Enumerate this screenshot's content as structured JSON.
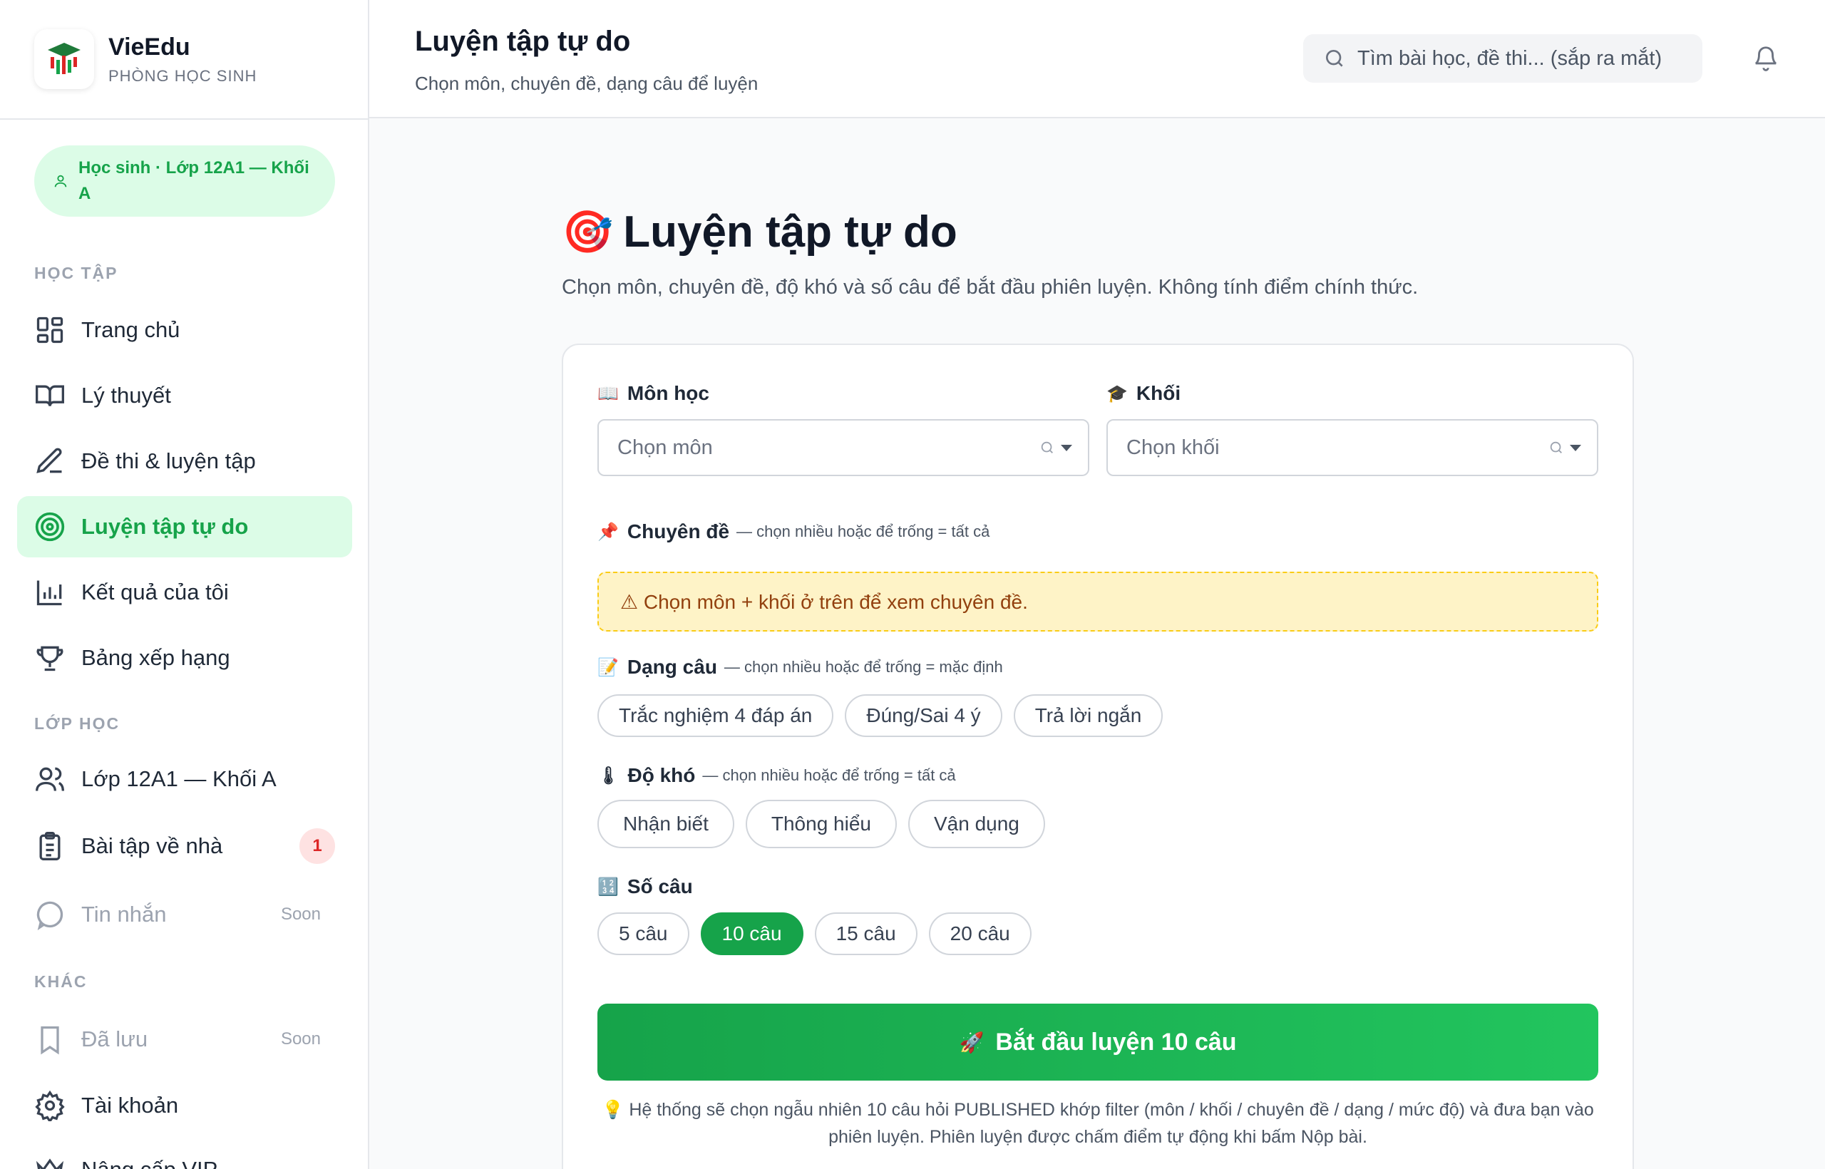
{
  "brand": {
    "name": "VieEdu",
    "subtitle": "PHÒNG HỌC SINH"
  },
  "role": {
    "label": "Học sinh · Lớp 12A1 — Khối A"
  },
  "sidebar": {
    "sections": [
      {
        "title": "HỌC TẬP"
      },
      {
        "title": "LỚP HỌC"
      },
      {
        "title": "KHÁC"
      }
    ],
    "items": [
      {
        "label": "Trang chủ",
        "icon": "grid-icon"
      },
      {
        "label": "Lý thuyết",
        "icon": "book-icon"
      },
      {
        "label": "Đề thi & luyện tập",
        "icon": "pencil-icon"
      },
      {
        "label": "Luyện tập tự do",
        "icon": "target-icon",
        "active": true
      },
      {
        "label": "Kết quả của tôi",
        "icon": "bar-chart-icon"
      },
      {
        "label": "Bảng xếp hạng",
        "icon": "trophy-icon"
      },
      {
        "label": "Lớp 12A1 — Khối A",
        "icon": "users-icon"
      },
      {
        "label": "Bài tập về nhà",
        "icon": "clipboard-icon",
        "badge": "1"
      },
      {
        "label": "Tin nhắn",
        "icon": "chat-icon",
        "soon": "Soon"
      },
      {
        "label": "Đã lưu",
        "icon": "bookmark-icon",
        "soon": "Soon"
      },
      {
        "label": "Tài khoản",
        "icon": "gear-icon"
      },
      {
        "label": "Nâng cấp VIP",
        "icon": "crown-icon"
      }
    ]
  },
  "topbar": {
    "title": "Luyện tập tự do",
    "subtitle": "Chọn môn, chuyên đề, dạng câu để luyện",
    "search_placeholder": "Tìm bài học, đề thi... (sắp ra mắt)"
  },
  "page": {
    "emoji": "🎯",
    "title": "Luyện tập tự do",
    "description": "Chọn môn, chuyên đề, độ khó và số câu để bắt đầu phiên luyện. Không tính điểm chính thức."
  },
  "form": {
    "subject": {
      "emoji": "📖",
      "label": "Môn học",
      "placeholder": "Chọn môn"
    },
    "grade": {
      "emoji": "🎓",
      "label": "Khối",
      "placeholder": "Chọn khối"
    },
    "topic": {
      "emoji": "📌",
      "label": "Chuyên đề",
      "hint": "— chọn nhiều hoặc để trống = tất cả",
      "warning": "⚠ Chọn môn + khối ở trên để xem chuyên đề."
    },
    "question_type": {
      "emoji": "📝",
      "label": "Dạng câu",
      "hint": "— chọn nhiều hoặc để trống = mặc định",
      "options": [
        "Trắc nghiệm 4 đáp án",
        "Đúng/Sai 4 ý",
        "Trả lời ngắn"
      ]
    },
    "difficulty": {
      "emoji": "🌡",
      "label": "Độ khó",
      "hint": "— chọn nhiều hoặc để trống = tất cả",
      "options": [
        "Nhận biết",
        "Thông hiểu",
        "Vận dụng"
      ]
    },
    "count": {
      "emoji": "🔢",
      "label": "Số câu",
      "options": [
        "5 câu",
        "10 câu",
        "15 câu",
        "20 câu"
      ],
      "selected": "10 câu"
    },
    "start_button": {
      "emoji": "🚀",
      "label": "Bắt đầu luyện 10 câu"
    },
    "note_emoji": "💡",
    "note": "Hệ thống sẽ chọn ngẫu nhiên 10 câu hỏi PUBLISHED khớp filter (môn / khối / chuyên đề / dạng / mức độ) và đưa bạn vào phiên luyện. Phiên luyện được chấm điểm tự động khi bấm Nộp bài."
  },
  "colors": {
    "accent": "#16a34a",
    "accent_light": "#dcfce7",
    "warning_bg": "#fef3c7",
    "badge_bg": "#fee2e2"
  }
}
